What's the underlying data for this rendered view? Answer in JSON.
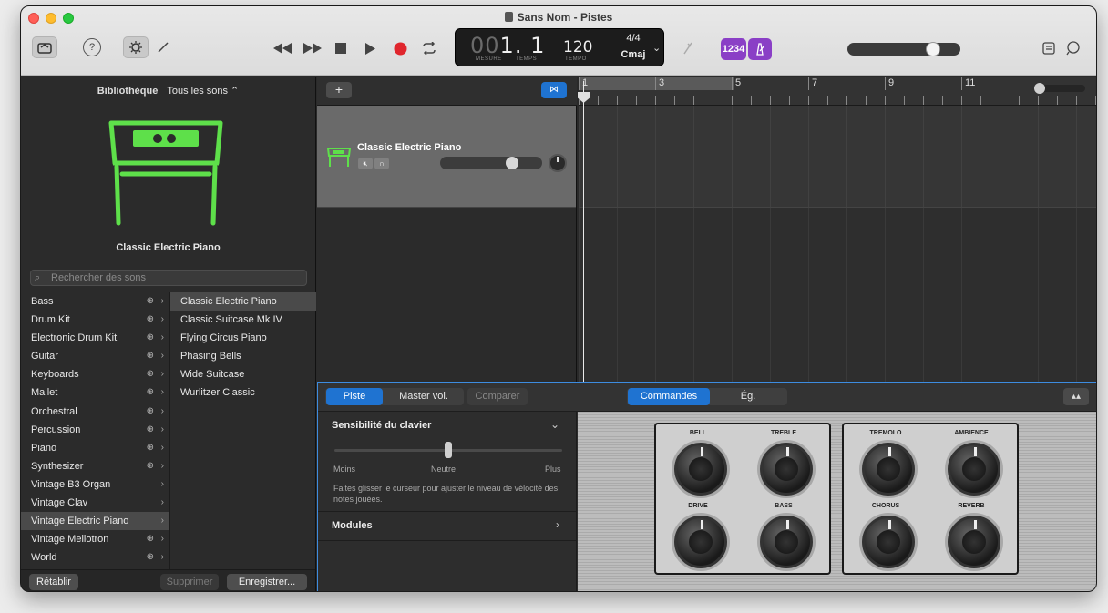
{
  "window": {
    "title": "Sans Nom - Pistes"
  },
  "lcd": {
    "pos_dim": "00",
    "pos": "1. 1",
    "mesure": "MESURE",
    "temps": "TEMPS",
    "tempo": "120",
    "tempo_lbl": "TEMPO",
    "signature": "4/4",
    "key": "Cmaj"
  },
  "toolbar": {
    "count_in": "1234",
    "help": "?"
  },
  "library": {
    "header": "Bibliothèque",
    "filter": "Tous les sons ⌃",
    "selected_name": "Classic Electric Piano",
    "search_placeholder": "Rechercher des sons",
    "categories": [
      {
        "label": "Bass",
        "dl": true
      },
      {
        "label": "Drum Kit",
        "dl": true
      },
      {
        "label": "Electronic Drum Kit",
        "dl": true
      },
      {
        "label": "Guitar",
        "dl": true
      },
      {
        "label": "Keyboards",
        "dl": true
      },
      {
        "label": "Mallet",
        "dl": true
      },
      {
        "label": "Orchestral",
        "dl": true
      },
      {
        "label": "Percussion",
        "dl": true
      },
      {
        "label": "Piano",
        "dl": true
      },
      {
        "label": "Synthesizer",
        "dl": true
      },
      {
        "label": "Vintage B3 Organ",
        "dl": false
      },
      {
        "label": "Vintage Clav",
        "dl": false
      },
      {
        "label": "Vintage Electric Piano",
        "dl": false,
        "selected": true
      },
      {
        "label": "Vintage Mellotron",
        "dl": true
      },
      {
        "label": "World",
        "dl": true
      }
    ],
    "patches": [
      "Classic Electric Piano",
      "Classic Suitcase Mk IV",
      "Flying Circus Piano",
      "Phasing Bells",
      "Wide Suitcase",
      "Wurlitzer Classic"
    ],
    "revert": "Rétablir",
    "delete": "Supprimer",
    "save": "Enregistrer..."
  },
  "tracks": {
    "add": "+",
    "track_name": "Classic Electric Piano"
  },
  "ruler": {
    "bars": [
      "1",
      "3",
      "5",
      "7",
      "9",
      "11"
    ]
  },
  "smart": {
    "tab_track": "Piste",
    "tab_master": "Master vol.",
    "compare": "Comparer",
    "tab_controls": "Commandes",
    "tab_eq": "Ég.",
    "sensitivity_title": "Sensibilité du clavier",
    "velocity_fraction": 0.5,
    "less": "Moins",
    "neutral": "Neutre",
    "more": "Plus",
    "help": "Faites glisser le curseur pour ajuster le niveau de vélocité des notes jouées.",
    "modules": "Modules",
    "knobs_left": [
      {
        "label": "BELL"
      },
      {
        "label": "TREBLE"
      },
      {
        "label": "DRIVE"
      },
      {
        "label": "BASS"
      }
    ],
    "knobs_right": [
      {
        "label": "TREMOLO"
      },
      {
        "label": "AMBIENCE"
      },
      {
        "label": "CHORUS"
      },
      {
        "label": "REVERB"
      }
    ]
  }
}
